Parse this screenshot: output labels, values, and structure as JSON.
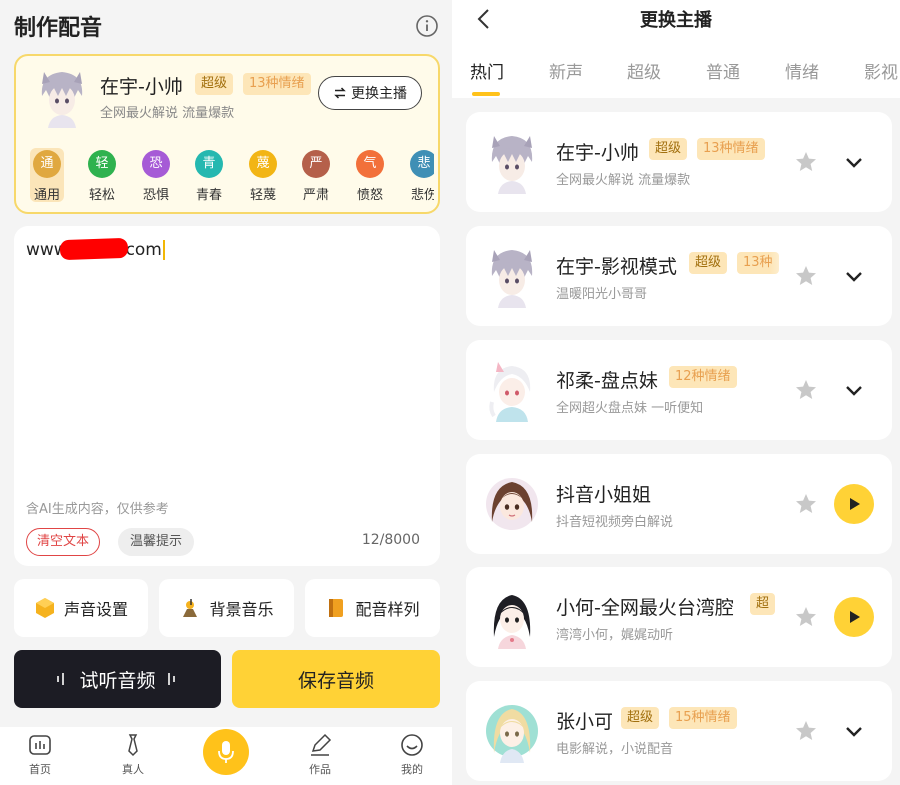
{
  "left": {
    "title": "制作配音",
    "current_anchor": {
      "name": "在宇-小帅",
      "badge_super": "超级",
      "badge_emotions": "13种情绪",
      "subtitle": "全网最火解说 流量爆款",
      "switch_label": "更换主播"
    },
    "emotions": [
      {
        "char": "通",
        "label": "通用",
        "color": "#e0a840"
      },
      {
        "char": "轻",
        "label": "轻松",
        "color": "#2fb24f"
      },
      {
        "char": "恐",
        "label": "恐惧",
        "color": "#a65bd6"
      },
      {
        "char": "青",
        "label": "青春",
        "color": "#25b8b0"
      },
      {
        "char": "蔑",
        "label": "轻蔑",
        "color": "#f2b515"
      },
      {
        "char": "严",
        "label": "严肃",
        "color": "#b5604a"
      },
      {
        "char": "气",
        "label": "愤怒",
        "color": "#f2703a"
      },
      {
        "char": "悲",
        "label": "悲伤",
        "color": "#3f8fb5"
      }
    ],
    "text_prefix": "www.",
    "text_suffix": "com",
    "ai_note": "含AI生成内容，仅供参考",
    "clear_label": "清空文本",
    "tip_label": "温馨提示",
    "char_count": "12/8000",
    "tools": {
      "voice_settings": "声音设置",
      "bg_music": "背景音乐",
      "samples": "配音样列"
    },
    "preview_label": "试听音频",
    "save_label": "保存音频",
    "nav": {
      "home": "首页",
      "human": "真人",
      "works": "作品",
      "mine": "我的"
    }
  },
  "right": {
    "title": "更换主播",
    "tabs": [
      "热门",
      "新声",
      "超级",
      "普通",
      "情绪",
      "影视"
    ],
    "active_tab": "热门",
    "anchors": [
      {
        "name": "在宇-小帅",
        "badges": [
          {
            "text": "超级",
            "kind": "super"
          },
          {
            "text": "13种情绪",
            "kind": "emo"
          }
        ],
        "subtitle": "全网最火解说 流量爆款",
        "action": "expand"
      },
      {
        "name": "在宇-影视模式",
        "badges": [
          {
            "text": "超级",
            "kind": "super"
          },
          {
            "text": "13种",
            "kind": "emo"
          }
        ],
        "subtitle": "温暖阳光小哥哥",
        "action": "expand"
      },
      {
        "name": "祁柔-盘点妹",
        "badges": [
          {
            "text": "12种情绪",
            "kind": "emo"
          }
        ],
        "subtitle": "全网超火盘点妹 一听便知",
        "action": "expand"
      },
      {
        "name": "抖音小姐姐",
        "badges": [],
        "subtitle": "抖音短视频旁白解说",
        "action": "play"
      },
      {
        "name": "小何-全网最火台湾腔",
        "badges": [
          {
            "text": "超",
            "kind": "super"
          }
        ],
        "subtitle": "湾湾小何，娓娓动听",
        "action": "play"
      },
      {
        "name": "张小可",
        "badges": [
          {
            "text": "超级",
            "kind": "super"
          },
          {
            "text": "15种情绪",
            "kind": "emo"
          }
        ],
        "subtitle": "电影解说，小说配音",
        "action": "expand"
      }
    ]
  }
}
